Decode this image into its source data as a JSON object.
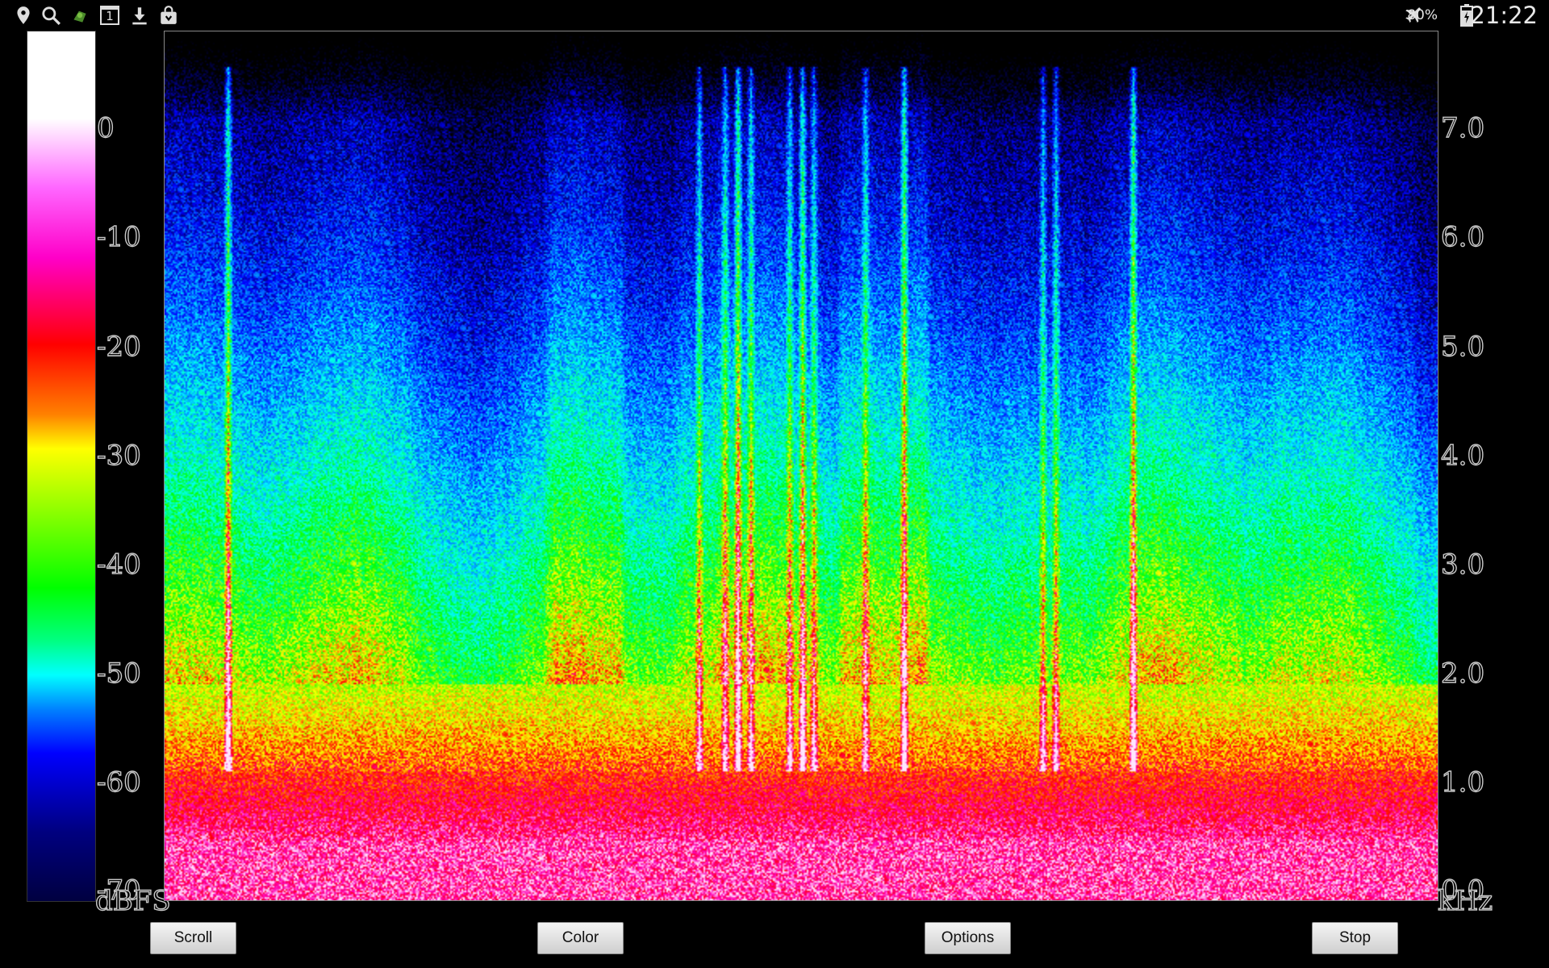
{
  "status_bar": {
    "left_icons": [
      "location-pin-icon",
      "search-icon",
      "android-robot-icon",
      "calendar-icon",
      "download-icon",
      "shopping-bag-icon"
    ],
    "calendar_day": "1",
    "airplane_icon": "airplane-icon",
    "battery_percent": "80%",
    "battery_icon": "battery-charging-icon",
    "time": "21:22"
  },
  "color_scale": {
    "unit": "dBFS",
    "ticks": [
      "0",
      "-10",
      "-20",
      "-30",
      "-40",
      "-50",
      "-60",
      "-70"
    ],
    "colors": [
      "#ffffff",
      "#ff00ff",
      "#ff0000",
      "#ff8000",
      "#ffff00",
      "#00ff00",
      "#00ffff",
      "#0000ff",
      "#000080"
    ]
  },
  "frequency_axis": {
    "unit": "kHz",
    "ticks": [
      "7.0",
      "6.0",
      "5.0",
      "4.0",
      "3.0",
      "2.0",
      "1.0",
      "0.0"
    ]
  },
  "chart_data": {
    "type": "heatmap",
    "title": "",
    "xlabel": "",
    "ylabel": "kHz",
    "colorbar_label": "dBFS",
    "ylim": [
      0,
      8
    ],
    "yticks": [
      0,
      1,
      2,
      3,
      4,
      5,
      6,
      7
    ],
    "color_range_dbfs": [
      -70,
      0
    ],
    "description_values": {
      "strong_low_band_khz": [
        0,
        0.3
      ],
      "vertical_streak_positions_fraction": [
        0.05,
        0.42,
        0.44,
        0.45,
        0.46,
        0.49,
        0.5,
        0.51,
        0.55,
        0.58,
        0.69,
        0.7,
        0.76
      ]
    }
  },
  "buttons": {
    "scroll": "Scroll",
    "color": "Color",
    "options": "Options",
    "stop": "Stop"
  }
}
